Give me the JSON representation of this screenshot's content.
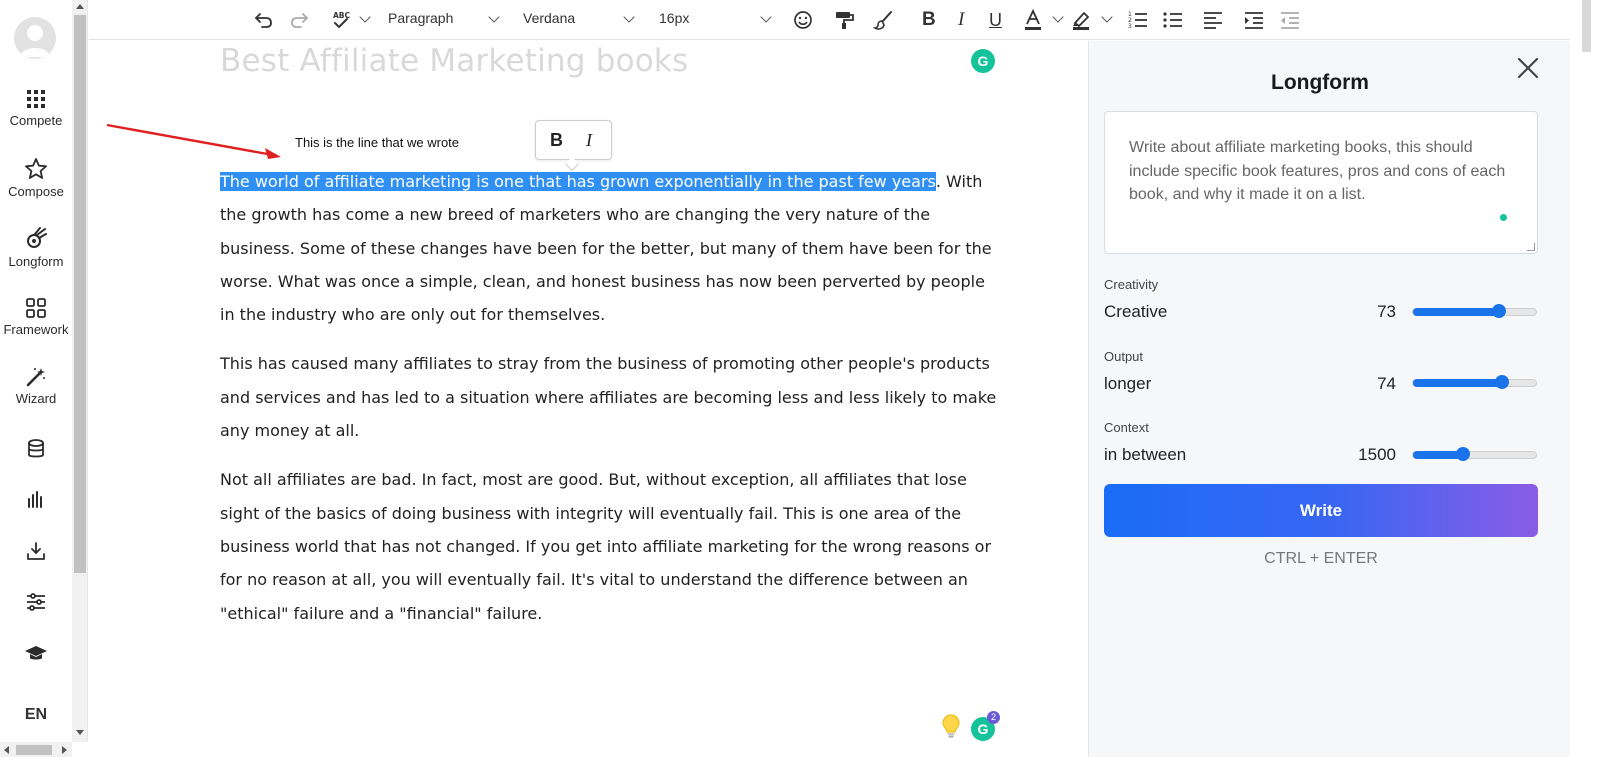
{
  "sidebar": {
    "items": [
      {
        "label": "Compete",
        "icon": "grid-icon"
      },
      {
        "label": "Compose",
        "icon": "star-icon"
      },
      {
        "label": "Longform",
        "icon": "comet-icon"
      },
      {
        "label": "Framework",
        "icon": "framework-icon"
      },
      {
        "label": "Wizard",
        "icon": "magic-wand-icon"
      },
      {
        "label": "",
        "icon": "database-icon"
      },
      {
        "label": "",
        "icon": "bar-chart-icon"
      },
      {
        "label": "",
        "icon": "download-icon"
      },
      {
        "label": "",
        "icon": "sliders-icon"
      },
      {
        "label": "",
        "icon": "graduation-cap-icon"
      }
    ],
    "language": "EN"
  },
  "toolbar": {
    "block_format": "Paragraph",
    "font_family": "Verdana",
    "font_size": "16px"
  },
  "editor": {
    "title": "Best Affiliate Marketing books",
    "annotation": "This is the line that we wrote",
    "float_bold": "B",
    "float_italic": "I",
    "highlighted": "The world of affiliate marketing is one that has grown exponentially in the past few years",
    "p1_rest": ". With the growth has come a new breed of marketers who are changing the very nature of the business. Some of these changes have been for the better, but many of them have been for the worse. What was once a simple, clean, and honest business has now been perverted by people in the industry who are only out for themselves.",
    "p2": "This has caused many affiliates to stray from the business of promoting other people's products and services and has led to a situation where affiliates are becoming less and less likely to make any money at all.",
    "p3": "Not all affiliates are bad. In fact, most are good. But, without exception, all affiliates that lose sight of the basics of doing business with integrity will eventually fail. This is one area of the business world that has not changed. If you get into affiliate marketing for the wrong reasons or for no reason at all, you will eventually fail. It's vital to understand the difference between an \"ethical\" failure and a \"financial\" failure.",
    "grammarly_count": "2"
  },
  "panel": {
    "title": "Longform",
    "prompt": "Write about affiliate marketing books, this should include specific book features, pros and cons of each book, and why it made it on a list.",
    "controls": [
      {
        "label": "Creativity",
        "value_text": "Creative",
        "number": "73",
        "fraction": 0.7
      },
      {
        "label": "Output",
        "value_text": "longer",
        "number": "74",
        "fraction": 0.72
      },
      {
        "label": "Context",
        "value_text": "in between",
        "number": "1500",
        "fraction": 0.41
      }
    ],
    "write_label": "Write",
    "shortcut": "CTRL + ENTER"
  },
  "colors": {
    "accent": "#1a73e8",
    "highlight": "#2f8ff3",
    "grammarly": "#15c39a",
    "write_gradient_end": "#8b5ce6"
  }
}
